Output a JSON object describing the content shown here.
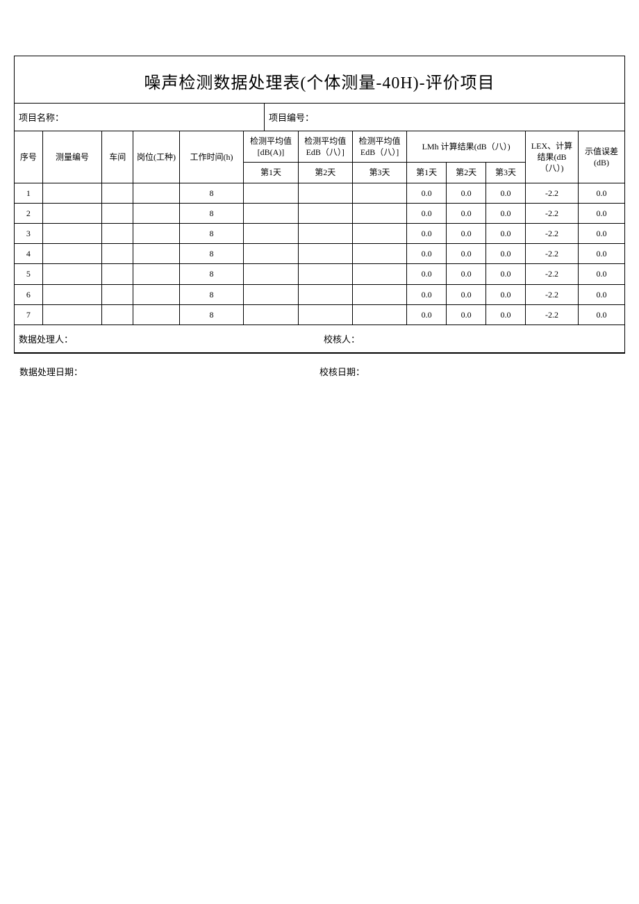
{
  "title": "噪声检测数据处理表(个体测量-40H)-评价项目",
  "meta": {
    "project_name_label": "项目名称：",
    "project_name_value": "",
    "project_no_label": "项目编号：",
    "project_no_value": ""
  },
  "headers": {
    "seq": "序号",
    "mid": "测量编号",
    "shop": "车间",
    "post": "岗位(工种)",
    "time": "工作时间(h)",
    "avg1": "检测平均值 [dB(A)]",
    "avg2": "检测平均值 EdB（八）]",
    "avg3": "检测平均值 EdB（八）]",
    "lmh_group": "LMh 计算结果(dB（八）)",
    "lex": "LEX、计算结果(dB（八）)",
    "err": "示值误差(dB)",
    "day1": "第1天",
    "day2": "第2天",
    "day3": "第3天"
  },
  "rows": [
    {
      "seq": "1",
      "mid": "",
      "shop": "",
      "post": "",
      "time": "8",
      "a1": "",
      "a2": "",
      "a3": "",
      "l1": "0.0",
      "l2": "0.0",
      "l3": "0.0",
      "lex": "-2.2",
      "err": "0.0"
    },
    {
      "seq": "2",
      "mid": "",
      "shop": "",
      "post": "",
      "time": "8",
      "a1": "",
      "a2": "",
      "a3": "",
      "l1": "0.0",
      "l2": "0.0",
      "l3": "0.0",
      "lex": "-2.2",
      "err": "0.0"
    },
    {
      "seq": "3",
      "mid": "",
      "shop": "",
      "post": "",
      "time": "8",
      "a1": "",
      "a2": "",
      "a3": "",
      "l1": "0.0",
      "l2": "0.0",
      "l3": "0.0",
      "lex": "-2.2",
      "err": "0.0"
    },
    {
      "seq": "4",
      "mid": "",
      "shop": "",
      "post": "",
      "time": "8",
      "a1": "",
      "a2": "",
      "a3": "",
      "l1": "0.0",
      "l2": "0.0",
      "l3": "0.0",
      "lex": "-2.2",
      "err": "0.0"
    },
    {
      "seq": "5",
      "mid": "",
      "shop": "",
      "post": "",
      "time": "8",
      "a1": "",
      "a2": "",
      "a3": "",
      "l1": "0.0",
      "l2": "0.0",
      "l3": "0.0",
      "lex": "-2.2",
      "err": "0.0"
    },
    {
      "seq": "6",
      "mid": "",
      "shop": "",
      "post": "",
      "time": "8",
      "a1": "",
      "a2": "",
      "a3": "",
      "l1": "0.0",
      "l2": "0.0",
      "l3": "0.0",
      "lex": "-2.2",
      "err": "0.0"
    },
    {
      "seq": "7",
      "mid": "",
      "shop": "",
      "post": "",
      "time": "8",
      "a1": "",
      "a2": "",
      "a3": "",
      "l1": "0.0",
      "l2": "0.0",
      "l3": "0.0",
      "lex": "-2.2",
      "err": "0.0"
    }
  ],
  "footer_in": {
    "processor_label": "数据处理人：",
    "processor_value": "",
    "reviewer_label": "校核人：",
    "reviewer_value": ""
  },
  "footer_out": {
    "process_date_label": "数据处理日期：",
    "process_date_value": "",
    "review_date_label": "校核日期：",
    "review_date_value": ""
  }
}
